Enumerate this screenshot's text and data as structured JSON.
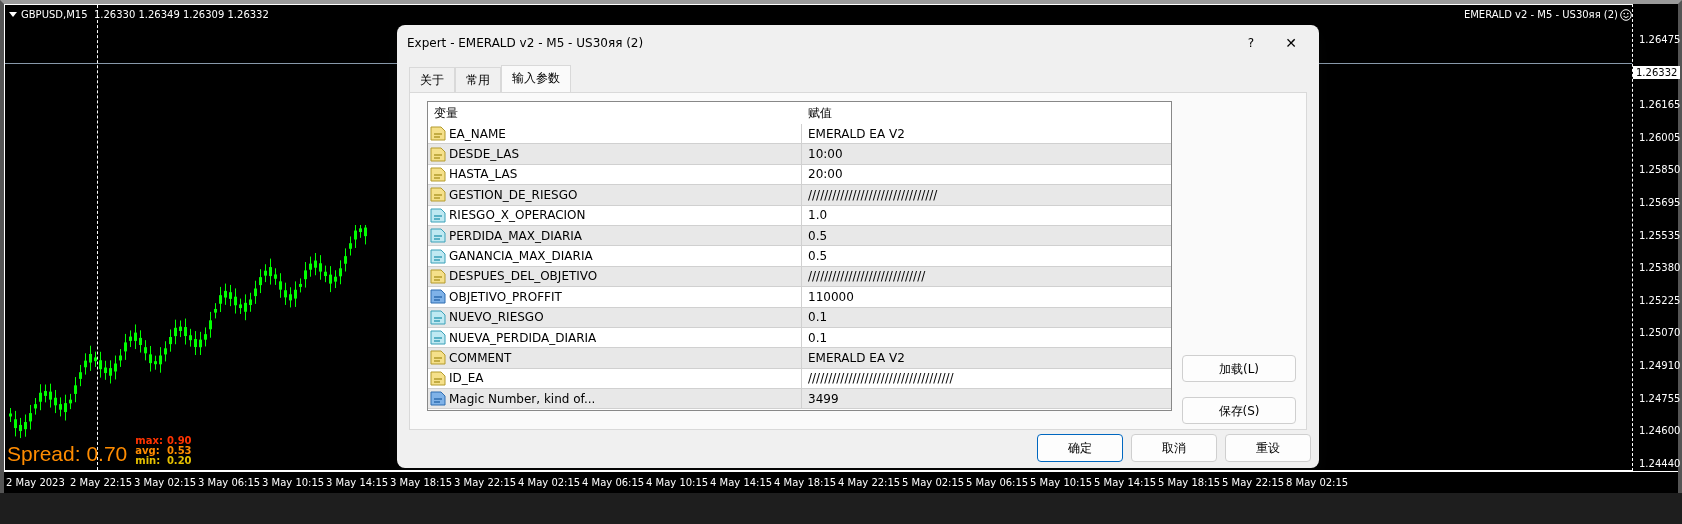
{
  "chart": {
    "symbol_line": "GBPUSD,M15  1.26330 1.26349 1.26309 1.26332",
    "expert_label": "EMERALD v2 - M5 - US30яя (2)",
    "price_ticks": [
      "1.26475",
      "1.26165",
      "1.26005",
      "1.25850",
      "1.25695",
      "1.25535",
      "1.25380",
      "1.25225",
      "1.25070",
      "1.24910",
      "1.24755",
      "1.24600",
      "1.24440"
    ],
    "current_price": "1.26332",
    "time_ticks": [
      "2 May 2023",
      "2 May 22:15",
      "3 May 02:15",
      "3 May 06:15",
      "3 May 10:15",
      "3 May 14:15",
      "3 May 18:15",
      "3 May 22:15",
      "4 May 02:15",
      "4 May 06:15",
      "4 May 10:15",
      "4 May 14:15",
      "4 May 18:15",
      "4 May 22:15",
      "5 May 02:15",
      "5 May 06:15",
      "5 May 10:15",
      "5 May 14:15",
      "5 May 18:15",
      "5 May 22:15",
      "8 May 02:15"
    ],
    "spread": {
      "text": "Spread: 0.70",
      "stats": [
        {
          "label": "max:",
          "value": "0.90",
          "color": "#ff3300"
        },
        {
          "label": "avg:",
          "value": "0.53",
          "color": "#ff8c00"
        },
        {
          "label": "min:",
          "value": "0.20",
          "color": "#e6c000"
        }
      ]
    }
  },
  "dialog": {
    "title": "Expert - EMERALD v2 - M5 - US30яя (2)",
    "help": "?",
    "close": "✕",
    "tabs": [
      {
        "label": "关于",
        "selected": false
      },
      {
        "label": "常用",
        "selected": false
      },
      {
        "label": "输入参数",
        "selected": true
      }
    ],
    "table": {
      "columns": [
        "变量",
        "赋值"
      ],
      "rows": [
        {
          "kind": "string",
          "name": "EA_NAME",
          "value": "EMERALD EA V2"
        },
        {
          "kind": "string",
          "name": "DESDE_LAS",
          "value": "10:00"
        },
        {
          "kind": "string",
          "name": "HASTA_LAS",
          "value": "20:00"
        },
        {
          "kind": "string",
          "name": "GESTION_DE_RIESGO",
          "value": "////////////////////////////////"
        },
        {
          "kind": "double",
          "name": "RIESGO_X_OPERACION",
          "value": "1.0"
        },
        {
          "kind": "double",
          "name": "PERDIDA_MAX_DIARIA",
          "value": "0.5"
        },
        {
          "kind": "double",
          "name": "GANANCIA_MAX_DIARIA",
          "value": "0.5"
        },
        {
          "kind": "string",
          "name": "DESPUES_DEL_OBJETIVO",
          "value": "/////////////////////////////"
        },
        {
          "kind": "int",
          "name": "OBJETIVO_PROFFIT",
          "value": "110000"
        },
        {
          "kind": "double",
          "name": "NUEVO_RIESGO",
          "value": "0.1"
        },
        {
          "kind": "double",
          "name": "NUEVA_PERDIDA_DIARIA",
          "value": "0.1"
        },
        {
          "kind": "string",
          "name": "COMMENT",
          "value": "EMERALD EA V2"
        },
        {
          "kind": "string",
          "name": "ID_EA",
          "value": "////////////////////////////////////"
        },
        {
          "kind": "int",
          "name": "Magic Number, kind of...",
          "value": "3499"
        }
      ]
    },
    "side_buttons": [
      "加载(L)",
      "保存(S)"
    ],
    "footer_buttons": [
      {
        "label": "确定",
        "default": true
      },
      {
        "label": "取消",
        "default": false
      },
      {
        "label": "重设",
        "default": false
      }
    ]
  }
}
